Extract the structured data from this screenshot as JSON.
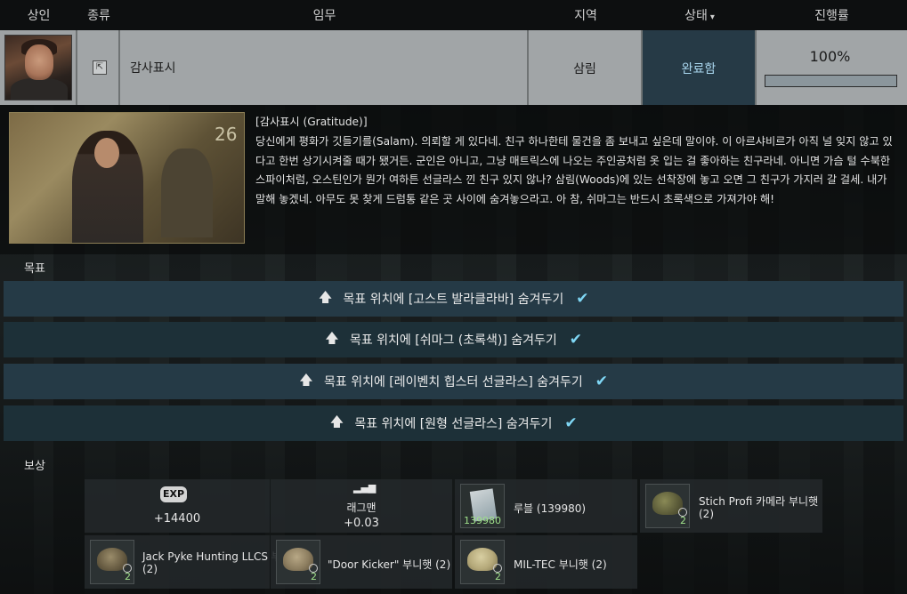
{
  "header": {
    "trader": "상인",
    "type": "종류",
    "task": "임무",
    "location": "지역",
    "status": "상태",
    "progress": "진행률"
  },
  "quest": {
    "name": "감사표시",
    "location": "삼림",
    "status": "완료함",
    "progress_text": "100%",
    "progress_value": 1.0
  },
  "description": {
    "title": "[감사표시 (Gratitude)]",
    "body": "당신에게 평화가 깃들기를(Salam). 의뢰할 게 있다네. 친구 하나한테 물건을 좀 보내고 싶은데 말이야. 이 아르샤비르가 아직 널 잊지 않고 있다고 한번 상기시켜줄 때가 됐거든. 군인은 아니고, 그냥 매트릭스에 나오는 주인공처럼 옷 입는 걸 좋아하는 친구라네. 아니면 가슴 털 수북한 스파이처럼, 오스틴인가 뭔가 여하튼 선글라스 낀 친구 있지 않나? 삼림(Woods)에 있는 선착장에 놓고 오면 그 친구가 가지러 갈 걸세. 내가 말해 놓겠네. 아무도 못 찾게 드럼통 같은 곳 사이에 숨겨놓으라고. 아 참, 쉬마그는 반드시 초록색으로 가져가야 해!"
  },
  "objectives_label": "목표",
  "objectives": [
    "목표 위치에 [고스트 발라클라바] 숨겨두기",
    "목표 위치에 [쉬마그 (초록색)] 숨겨두기",
    "목표 위치에 [레이벤치 힙스터 선글라스] 숨겨두기",
    "목표 위치에 [원형 선글라스] 숨겨두기"
  ],
  "rewards_label": "보상",
  "rewards": {
    "exp_badge": "EXP",
    "exp": "+14400",
    "rep_name": "래그맨",
    "rep": "+0.03",
    "money_name": "루블 (139980)",
    "money_count": "139980",
    "items": [
      {
        "name": "Stich Profi 카메라 부니햇",
        "qty": "(2)",
        "count": "2"
      },
      {
        "name": "Jack Pyke Hunting LLCS 부니햇",
        "qty": "(2)",
        "count": "2"
      },
      {
        "name": "\"Door Kicker\" 부니햇",
        "qty": "(2)",
        "count": "2"
      },
      {
        "name": "MIL-TEC 부니햇",
        "qty": "(2)",
        "count": "2"
      }
    ]
  },
  "colors": {
    "status_bg": "#263a46",
    "status_text": "#a9d6ee",
    "objective_bg": "#253a46",
    "check": "#7fd7f5",
    "count_green": "#9fe08a"
  },
  "icons": {
    "type": "exit-icon",
    "objective": "up-arrow-icon",
    "complete": "checkmark-icon",
    "status_sort": "chevron-down-icon",
    "reputation": "bar-growth-icon"
  }
}
